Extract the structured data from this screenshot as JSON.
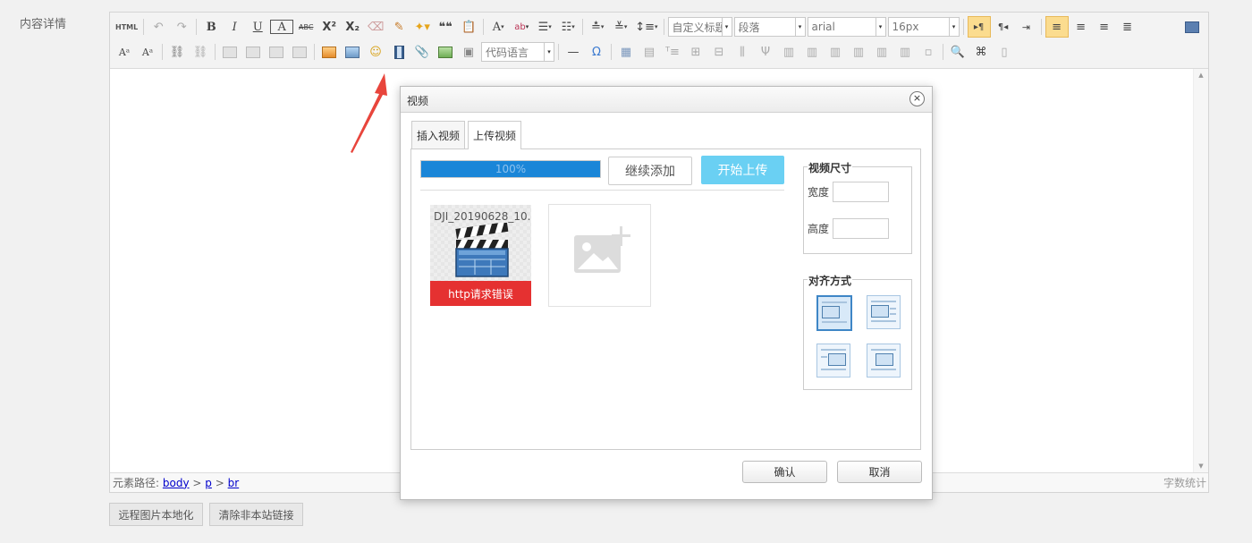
{
  "field_label": "内容详情",
  "toolbar": {
    "font_size_badge": "HTML",
    "bold": "B",
    "italic": "I",
    "underline": "U",
    "boxed": "A",
    "strike": "ABC",
    "superscript": "X²",
    "subscript": "X₂",
    "quote": "❝❝",
    "font_color": "A",
    "highlight": "ab",
    "omega": "Ω",
    "hr": "—",
    "custom_heading": "自定义标题",
    "paragraph": "段落",
    "font_family": "arial",
    "font_size": "16px",
    "code_language": "代码语言"
  },
  "statusbar": {
    "path_label": "元素路径:",
    "path": [
      "body",
      "p",
      "br"
    ],
    "path_sep": ">",
    "word_count": "字数统计"
  },
  "below_buttons": {
    "remote_local": "远程图片本地化",
    "clear_links": "清除非本站链接"
  },
  "dialog": {
    "title": "视频",
    "close": "×",
    "tabs": [
      "插入视频",
      "上传视频"
    ],
    "active_tab": 1,
    "upload": {
      "progress_percent": 100,
      "progress_text": "100%",
      "continue_add": "继续添加",
      "start_upload": "开始上传",
      "files": [
        {
          "name": "DJI_20190628_10...",
          "error": "http请求错误"
        }
      ]
    },
    "size": {
      "legend": "视频尺寸",
      "width_label": "宽度",
      "height_label": "高度",
      "width": "",
      "height": ""
    },
    "align": {
      "legend": "对齐方式",
      "selected": 0
    },
    "confirm": "确认",
    "cancel": "取消"
  },
  "colors": {
    "progress": "#1a86d8",
    "start_button": "#6ad0f3",
    "error": "#e53131",
    "arrow": "#e8453c"
  }
}
